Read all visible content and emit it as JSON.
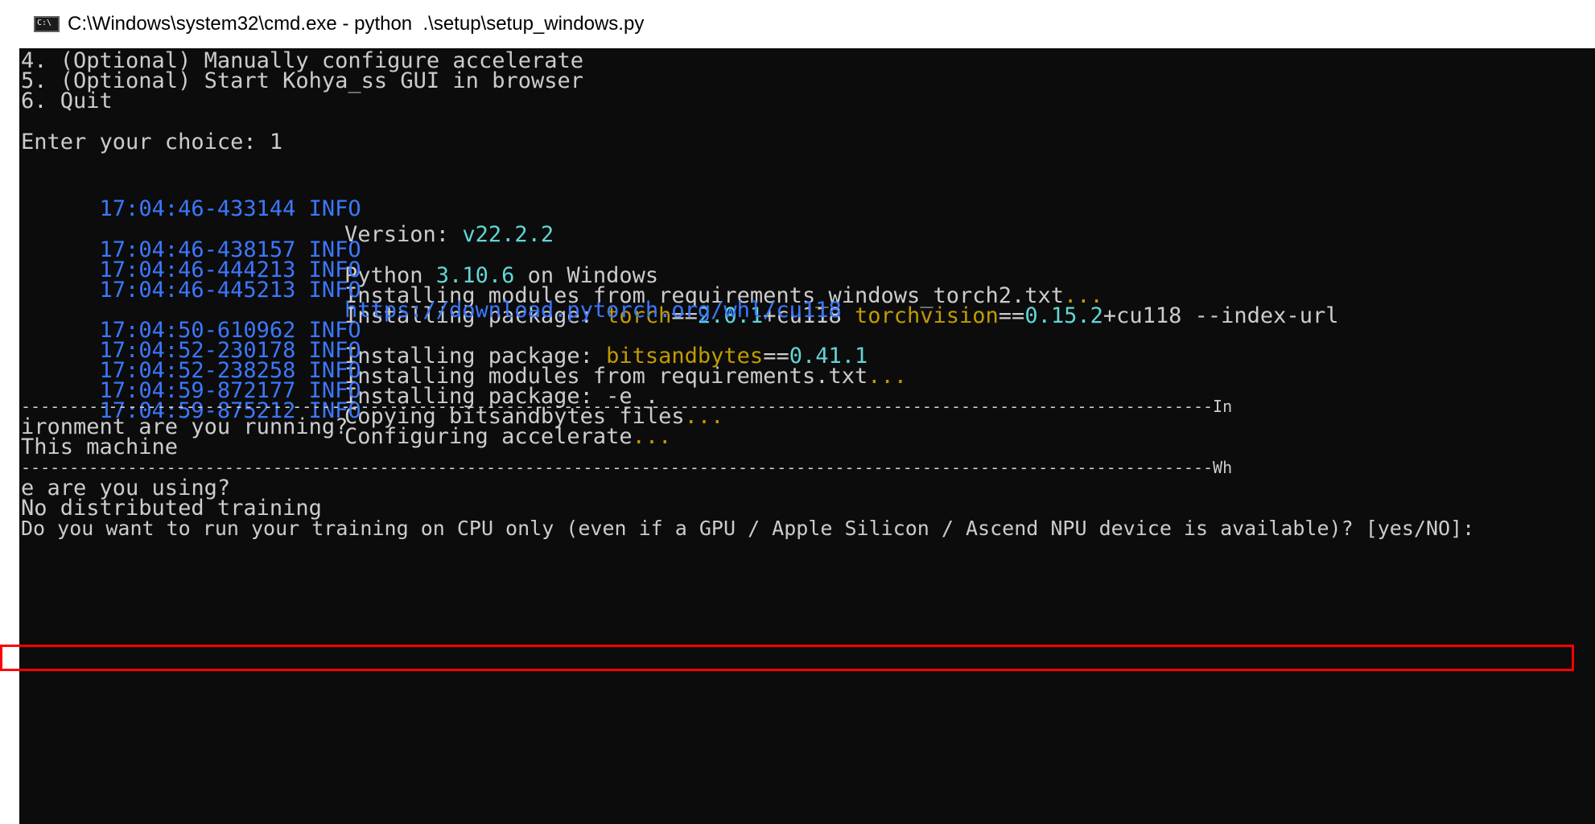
{
  "window": {
    "title": "C:\\Windows\\system32\\cmd.exe - python  .\\setup\\setup_windows.py"
  },
  "console": {
    "menu": [
      "4. (Optional) Manually configure accelerate",
      "5. (Optional) Start Kohya_ss GUI in browser",
      "6. Quit"
    ],
    "choice_prompt": "Enter your choice: 1",
    "logs": [
      {
        "time": "17:04:46-433144",
        "level": "INFO",
        "text": "Version: v22.2.2"
      },
      {
        "time": "17:04:46-438157",
        "level": "INFO",
        "text": "Python 3.10.6 on Windows"
      },
      {
        "time": "17:04:46-444213",
        "level": "INFO",
        "text": "Installing modules from requirements_windows_torch2.txt..."
      },
      {
        "time": "17:04:46-445213",
        "level": "INFO",
        "text": "Installing package: torch==2.0.1+cu118 torchvision==0.15.2+cu118 --index-url"
      },
      {
        "continuation": "https://download.pytorch.org/whl/cu118"
      },
      {
        "time": "17:04:50-610962",
        "level": "INFO",
        "text": "Installing package: bitsandbytes==0.41.1"
      },
      {
        "time": "17:04:52-230178",
        "level": "INFO",
        "text": "Installing modules from requirements.txt..."
      },
      {
        "time": "17:04:52-238258",
        "level": "INFO",
        "text": "Installing package: -e ."
      },
      {
        "time": "17:04:59-872177",
        "level": "INFO",
        "text": "Copying bitsandbytes files..."
      },
      {
        "time": "17:04:59-875212",
        "level": "INFO",
        "text": "Configuring accelerate..."
      }
    ],
    "separator_1": "---------------------------------------------------------------------------------------------------------------------------In",
    "question_1": "ironment are you running?",
    "answer_1": "This machine",
    "separator_2": "---------------------------------------------------------------------------------------------------------------------------Wh",
    "question_2": "e are you using?",
    "answer_2": "No distributed training",
    "current_prompt": "Do you want to run your training on CPU only (even if a GPU / Apple Silicon / Ascend NPU device is available)? [yes/NO]:"
  },
  "colors": {
    "timestamp": "#3b78ff",
    "number": "#61d6d6",
    "package": "#c19c00",
    "highlight_border": "#ff0000"
  }
}
